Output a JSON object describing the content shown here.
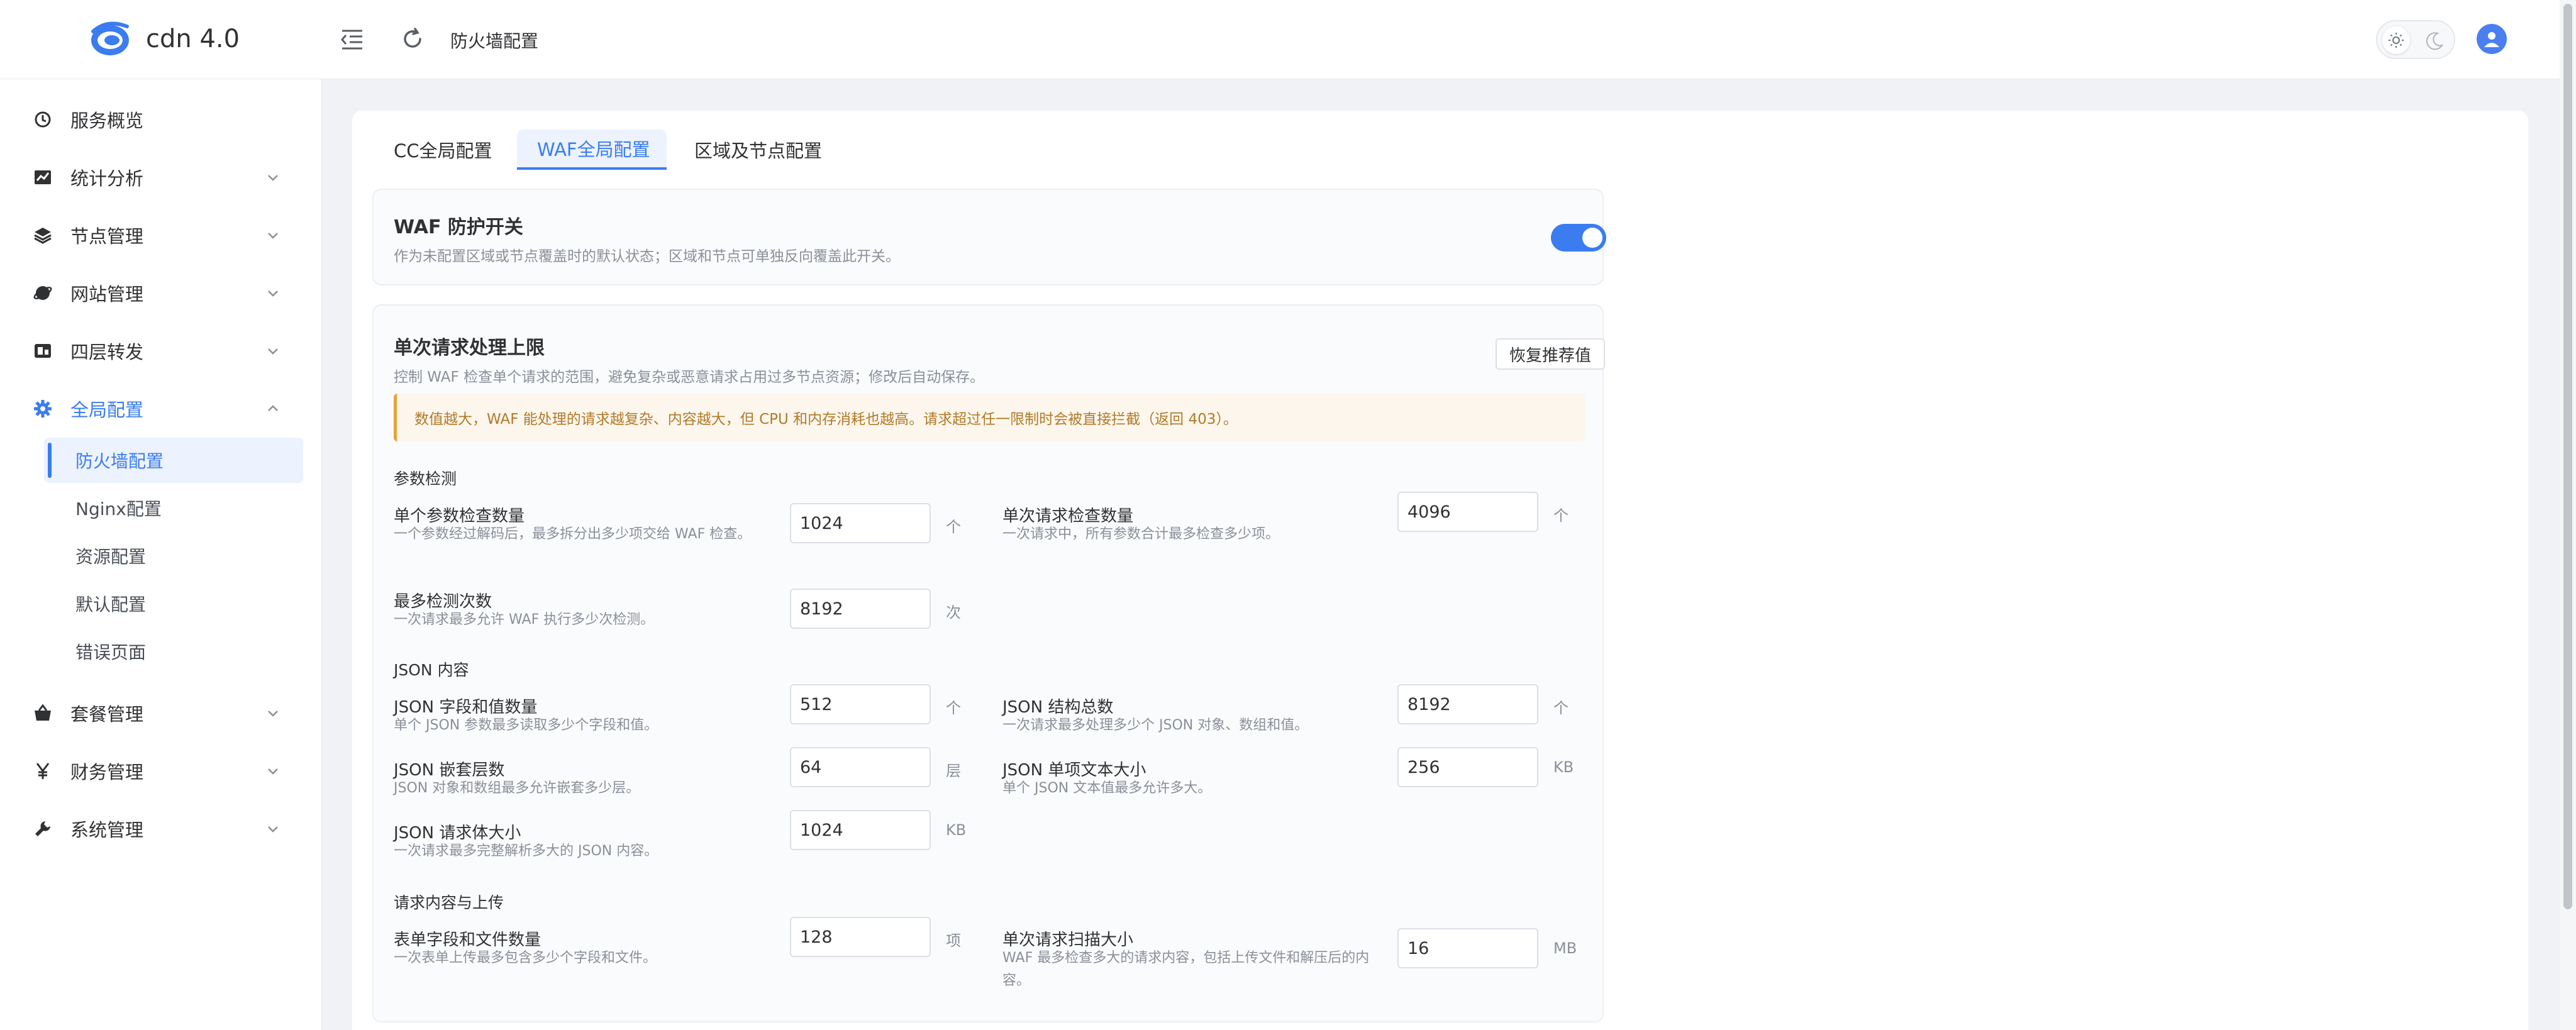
{
  "brand": {
    "name": "cdn 4.0"
  },
  "header": {
    "title": "防火墙配置"
  },
  "sidebar": {
    "items": [
      {
        "label": "服务概览",
        "icon": "dashboard-icon"
      },
      {
        "label": "统计分析",
        "icon": "chart-icon"
      },
      {
        "label": "节点管理",
        "icon": "layers-icon"
      },
      {
        "label": "网站管理",
        "icon": "globe-icon"
      },
      {
        "label": "四层转发",
        "icon": "forward-icon"
      },
      {
        "label": "全局配置",
        "icon": "gear-icon"
      },
      {
        "label": "套餐管理",
        "icon": "basket-icon"
      },
      {
        "label": "财务管理",
        "icon": "yen-icon"
      },
      {
        "label": "系统管理",
        "icon": "wrench-icon"
      }
    ],
    "sub_items": [
      {
        "label": "防火墙配置"
      },
      {
        "label": "Nginx配置"
      },
      {
        "label": "资源配置"
      },
      {
        "label": "默认配置"
      },
      {
        "label": "错误页面"
      }
    ]
  },
  "tabs": [
    {
      "label": "CC全局配置"
    },
    {
      "label": "WAF全局配置"
    },
    {
      "label": "区域及节点配置"
    }
  ],
  "waf_switch": {
    "title": "WAF 防护开关",
    "desc": "作为未配置区域或节点覆盖时的默认状态；区域和节点可单独反向覆盖此开关。",
    "enabled": true
  },
  "limits": {
    "title": "单次请求处理上限",
    "desc": "控制 WAF 检查单个请求的范围，避免复杂或恶意请求占用过多节点资源；修改后自动保存。",
    "restore_label": "恢复推荐值",
    "warning": "数值越大，WAF 能处理的请求越复杂、内容越大，但 CPU 和内存消耗也越高。请求超过任一限制时会被直接拦截（返回 403）。",
    "sections": [
      {
        "title": "参数检测"
      },
      {
        "title": "JSON 内容"
      },
      {
        "title": "请求内容与上传"
      }
    ],
    "fields": [
      {
        "label": "单个参数检查数量",
        "desc": "一个参数经过解码后，最多拆分出多少项交给 WAF 检查。",
        "value": "1024",
        "unit": "个"
      },
      {
        "label": "单次请求检查数量",
        "desc": "一次请求中，所有参数合计最多检查多少项。",
        "value": "4096",
        "unit": "个"
      },
      {
        "label": "最多检测次数",
        "desc": "一次请求最多允许 WAF 执行多少次检测。",
        "value": "8192",
        "unit": "次"
      },
      {
        "label": "JSON 字段和值数量",
        "desc": "单个 JSON 参数最多读取多少个字段和值。",
        "value": "512",
        "unit": "个"
      },
      {
        "label": "JSON 结构总数",
        "desc": "一次请求最多处理多少个 JSON 对象、数组和值。",
        "value": "8192",
        "unit": "个"
      },
      {
        "label": "JSON 嵌套层数",
        "desc": "JSON 对象和数组最多允许嵌套多少层。",
        "value": "64",
        "unit": "层"
      },
      {
        "label": "JSON 单项文本大小",
        "desc": "单个 JSON 文本值最多允许多大。",
        "value": "256",
        "unit": "KB"
      },
      {
        "label": "JSON 请求体大小",
        "desc": "一次请求最多完整解析多大的 JSON 内容。",
        "value": "1024",
        "unit": "KB"
      },
      {
        "label": "表单字段和文件数量",
        "desc": "一次表单上传最多包含多少个字段和文件。",
        "value": "128",
        "unit": "项"
      },
      {
        "label": "单次请求扫描大小",
        "desc": "WAF 最多检查多大的请求内容，包括上传文件和解压后的内容。",
        "value": "16",
        "unit": "MB"
      }
    ]
  },
  "colors": {
    "accent": "#3b7cf0",
    "warning_bg": "#fdf6ec",
    "warning_border": "#e6a23c"
  }
}
